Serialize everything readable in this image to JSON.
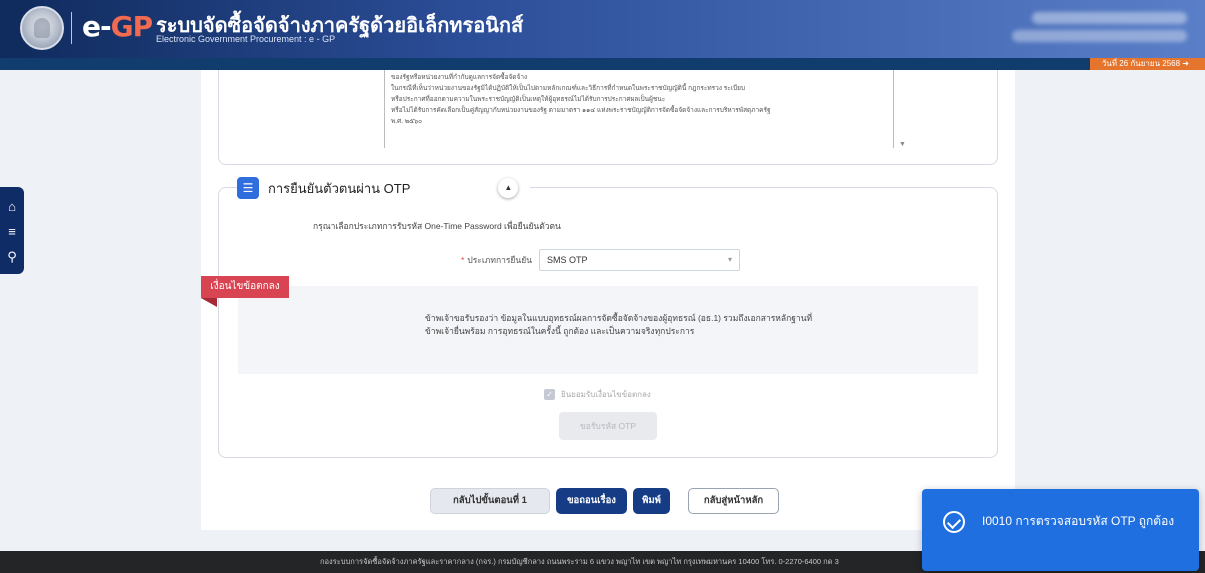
{
  "header": {
    "logo_prefix": "e-",
    "logo_suffix": "GP",
    "title": "ระบบจัดซื้อจัดจ้างภาครัฐด้วยอิเล็กทรอนิกส์",
    "subtitle": "Electronic Government Procurement : e - GP"
  },
  "datebar": {
    "date": "วันที่ 26 กันยายน 2568"
  },
  "sidenav": {
    "home_icon": "⌂",
    "menu_icon": "≡",
    "search_icon": "⚲"
  },
  "terms": {
    "lines": [
      "ของรัฐหรือหน่วยงานที่กำกับดูแลการจัดซื้อจัดจ้าง",
      "ในกรณีที่เห็นว่าหน่วยงานของรัฐมิได้ปฏิบัติให้เป็นไปตามหลักเกณฑ์และวิธีการที่กำหนดในพระราชบัญญัตินี้ กฎกระทรวง ระเบียบ",
      "หรือประกาศที่ออกตามความในพระราชบัญญัติเป็นเหตุให้ผู้อุทธรณ์ไม่ได้รับการประกาศผลเป็นผู้ชนะ",
      "หรือไม่ได้รับการคัดเลือกเป็นคู่สัญญากับหน่วยงานของรัฐ ตามมาตรา ๑๑๔ แห่งพระราชบัญญัติการจัดซื้อจัดจ้างและการบริหารพัสดุภาครัฐ",
      "พ.ศ. ๒๕๖๐"
    ]
  },
  "otp": {
    "title": "การยืนยันตัวตนผ่าน OTP",
    "icon": "☰",
    "toggle": "▲",
    "description": "กรุณาเลือกประเภทการรับรหัส One-Time Password เพื่อยืนยันตัวตน",
    "type_label": "ประเภทการยืนยัน",
    "required_mark": "*",
    "type_value": "SMS OTP",
    "select_chevron": "▾"
  },
  "conditions": {
    "tag": "เงื่อนไขข้อตกลง",
    "text": "ข้าพเจ้าขอรับรองว่า ข้อมูลในแบบอุทธรณ์ผลการจัดซื้อจัดจ้างของผู้อุทธรณ์ (อธ.1) รวมถึงเอกสารหลักฐานที่ข้าพเจ้ายื่นพร้อม การอุทธรณ์ในครั้งนี้ ถูกต้อง และเป็นความจริงทุกประการ",
    "agree_label": "ยินยอมรับเงื่อนไขข้อตกลง",
    "check_mark": "✓",
    "request_otp": "ขอรับรหัส OTP"
  },
  "actions": {
    "back": "กลับไปขั้นตอนที่ 1",
    "submit": "ขอถอนเรื่อง",
    "print": "พิมพ์",
    "home": "กลับสู่หน้าหลัก"
  },
  "footer": {
    "text": "กองระบบการจัดซื้อจัดจ้างภาครัฐและราคากลาง (กจร.) กรมบัญชีกลาง ถนนพระราม 6 แขวง พญาไท เขต พญาไท กรุงเทพมหานคร 10400 โทร. 0-2270-6400 กด 3"
  },
  "toast": {
    "message": "I0010 การตรวจสอบรหัส OTP ถูกต้อง"
  }
}
